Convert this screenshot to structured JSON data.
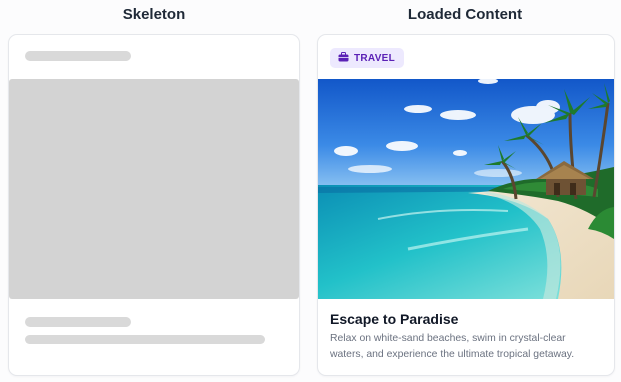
{
  "columns": {
    "skeleton_title": "Skeleton",
    "loaded_title": "Loaded Content"
  },
  "loaded_card": {
    "badge": {
      "icon": "briefcase-icon",
      "label": "TRAVEL"
    },
    "image": {
      "subject": "tropical-beach-photo"
    },
    "title": "Escape to Paradise",
    "description": "Relax on white-sand beaches, swim in crystal-clear waters, and experience the ultimate tropical getaway."
  },
  "colors": {
    "skeleton_gray": "#d9d9d9",
    "badge_bg": "#ede9fe",
    "badge_fg": "#5b21b6",
    "border": "#e5e7eb"
  }
}
